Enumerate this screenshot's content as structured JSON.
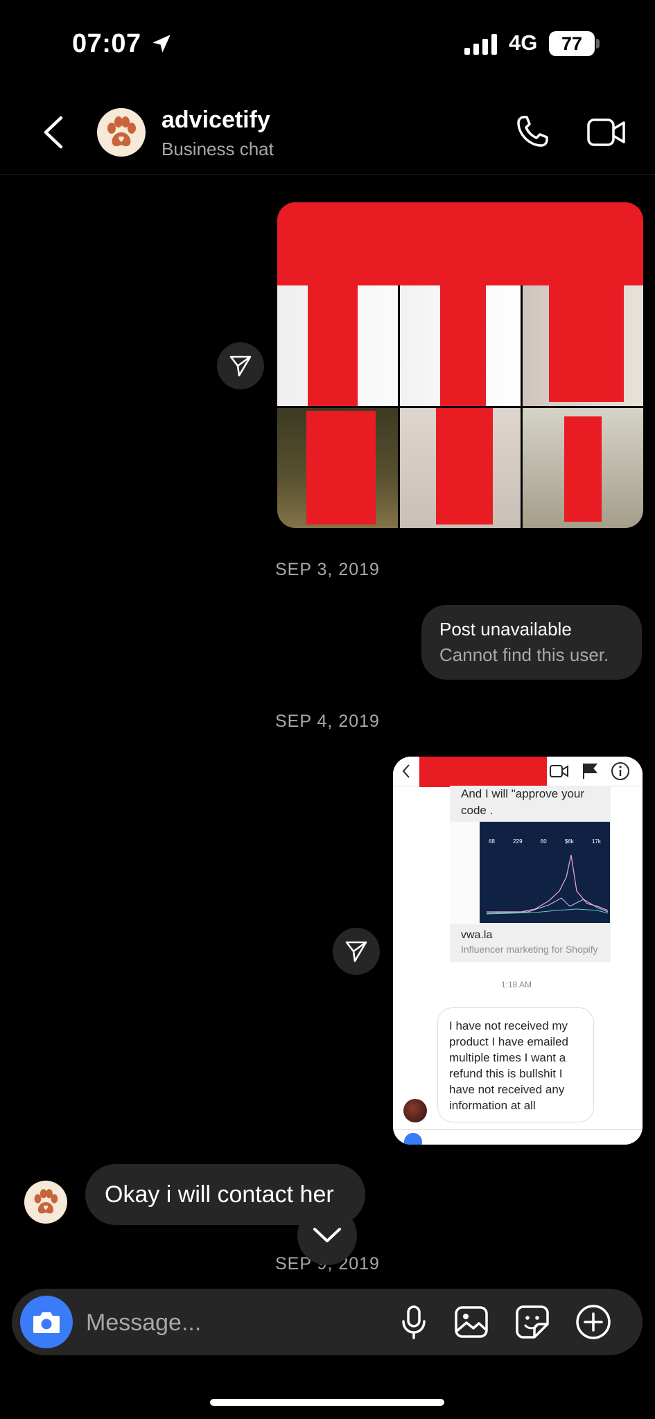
{
  "status_bar": {
    "time": "07:07",
    "network": "4G",
    "battery": "77"
  },
  "header": {
    "name": "advicetify",
    "subtitle": "Business chat"
  },
  "messages": {
    "date1": "SEP 3, 2019",
    "unavailable_title": "Post unavailable",
    "unavailable_sub": "Cannot find this user.",
    "date2": "SEP 4, 2019",
    "incoming_text": "Okay i will contact her",
    "date3": "SEP 9, 2019"
  },
  "screenshot": {
    "top_text": "And I will \"approve your code .",
    "link_domain": "vwa.la",
    "link_desc": "Influencer marketing for Shopify",
    "time": "1:18 AM",
    "bubble_text": "I have not received my product I have emailed multiple times I want a refund this is bullshit I have not received any information at all",
    "stats": [
      "68",
      "229",
      "60",
      "$6k",
      "17k"
    ]
  },
  "composer": {
    "placeholder": "Message..."
  },
  "colors": {
    "accent": "#3a7bf7",
    "redaction": "#e91c24",
    "bubble": "#262626"
  }
}
